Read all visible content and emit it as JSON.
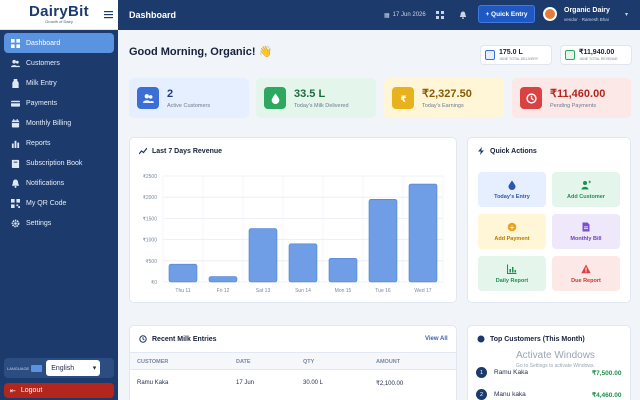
{
  "app": {
    "logo": "DairyBit",
    "logo_tagline": "Growth of Dairy"
  },
  "sidebar": {
    "items": [
      {
        "label": "Dashboard",
        "icon": "dashboard-icon",
        "active": true
      },
      {
        "label": "Customers",
        "icon": "users-icon"
      },
      {
        "label": "Milk Entry",
        "icon": "milk-icon"
      },
      {
        "label": "Payments",
        "icon": "payment-icon"
      },
      {
        "label": "Monthly Billing",
        "icon": "billing-icon"
      },
      {
        "label": "Reports",
        "icon": "reports-icon"
      },
      {
        "label": "Subscription Book",
        "icon": "book-icon"
      },
      {
        "label": "Notifications",
        "icon": "bell-icon"
      },
      {
        "label": "My QR Code",
        "icon": "qr-icon"
      },
      {
        "label": "Settings",
        "icon": "gear-icon"
      }
    ],
    "language_label": "LANGUAGE",
    "language_value": "English",
    "logout_label": "Logout"
  },
  "topbar": {
    "title": "Dashboard",
    "date": "17 Jun 2026",
    "quick_entry_label": "+ Quick Entry",
    "user_name": "Organic Dairy",
    "user_sub": "vendor · Ramesh Bhai"
  },
  "greeting": "Good Morning, Organic! 👋",
  "mini_stats": [
    {
      "value": "175.0 L",
      "label": "JUNE TOTAL DELIVERY",
      "color": "#3b6fd6"
    },
    {
      "value": "₹11,940.00",
      "label": "JUNE TOTAL REVENUE",
      "color": "#2ea85f"
    }
  ],
  "stats": [
    {
      "value": "2",
      "label": "Active Customers",
      "bg": "#e6efff",
      "icon_bg": "#3b6fd6",
      "value_color": "#1f3f85"
    },
    {
      "value": "33.5 L",
      "label": "Today's Milk Delivered",
      "bg": "#e4f6ec",
      "icon_bg": "#2ea85f",
      "value_color": "#1b6b3e"
    },
    {
      "value": "₹2,327.50",
      "label": "Today's Earnings",
      "bg": "#fff6d8",
      "icon_bg": "#e8b21f",
      "value_color": "#8a5a00"
    },
    {
      "value": "₹11,460.00",
      "label": "Pending Payments",
      "bg": "#fde8e8",
      "icon_bg": "#d94242",
      "value_color": "#b3261e"
    }
  ],
  "revenue_panel": {
    "title": "Last 7 Days Revenue"
  },
  "chart_data": {
    "type": "bar",
    "title": "Last 7 Days Revenue",
    "categories": [
      "Thu 11",
      "Fri 12",
      "Sat 13",
      "Sun 14",
      "Mon 15",
      "Tue 16",
      "Wed 17"
    ],
    "values": [
      420,
      130,
      1260,
      900,
      560,
      1950,
      2310
    ],
    "yticks": [
      "₹2500",
      "₹2000",
      "₹1500",
      "₹1000",
      "₹500",
      "₹0"
    ],
    "ylim": [
      0,
      2500
    ],
    "bar_color": "#6f9de6",
    "grid": true
  },
  "quick_actions": {
    "title": "Quick Actions",
    "tiles": [
      {
        "label": "Today's Entry",
        "bg": "#e6efff",
        "color": "#2c57b0",
        "icon": "drop-icon"
      },
      {
        "label": "Add Customer",
        "bg": "#e4f6ec",
        "color": "#1f8f4d",
        "icon": "add-user-icon"
      },
      {
        "label": "Add Payment",
        "bg": "#fff6d8",
        "color": "#b57a00",
        "icon": "coin-icon"
      },
      {
        "label": "Monthly Bill",
        "bg": "#efe8fb",
        "color": "#6b3fb8",
        "icon": "document-icon"
      },
      {
        "label": "Daily Report",
        "bg": "#e4f6ec",
        "color": "#1f8f4d",
        "icon": "chart-icon"
      },
      {
        "label": "Due Report",
        "bg": "#fde8e8",
        "color": "#c0392b",
        "icon": "warning-icon"
      }
    ]
  },
  "recent_entries": {
    "title": "Recent Milk Entries",
    "view_all": "View All",
    "columns": [
      "CUSTOMER",
      "DATE",
      "QTY",
      "AMOUNT"
    ],
    "rows": [
      [
        "Ramu Kaka",
        "17 Jun",
        "30.00 L",
        "₹2,100.00"
      ]
    ]
  },
  "top_customers": {
    "title": "Top Customers (This Month)",
    "items": [
      {
        "rank": "1",
        "name": "Ramu Kaka",
        "amount": "₹7,500.00"
      },
      {
        "rank": "2",
        "name": "Manu kaka",
        "amount": "₹4,460.00"
      }
    ]
  },
  "watermark": {
    "line1": "Activate Windows",
    "line2": "Go to Settings to activate Windows."
  }
}
